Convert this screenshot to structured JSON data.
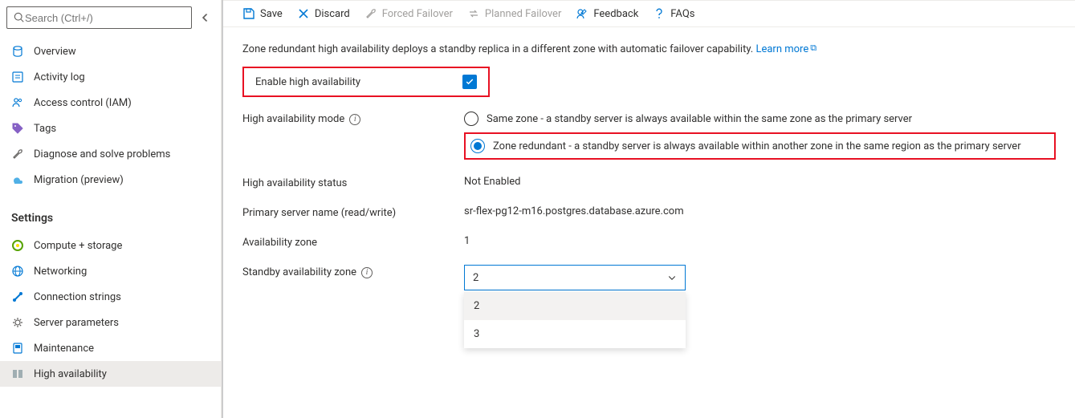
{
  "search": {
    "placeholder": "Search (Ctrl+/)"
  },
  "sidebar": {
    "items": [
      {
        "label": "Overview"
      },
      {
        "label": "Activity log"
      },
      {
        "label": "Access control (IAM)"
      },
      {
        "label": "Tags"
      },
      {
        "label": "Diagnose and solve problems"
      },
      {
        "label": "Migration (preview)"
      }
    ],
    "settings_label": "Settings",
    "settings_items": [
      {
        "label": "Compute + storage"
      },
      {
        "label": "Networking"
      },
      {
        "label": "Connection strings"
      },
      {
        "label": "Server parameters"
      },
      {
        "label": "Maintenance"
      },
      {
        "label": "High availability"
      }
    ]
  },
  "toolbar": {
    "save": "Save",
    "discard": "Discard",
    "forced_failover": "Forced Failover",
    "planned_failover": "Planned Failover",
    "feedback": "Feedback",
    "faqs": "FAQs"
  },
  "description_text": "Zone redundant high availability deploys a standby replica in a different zone with automatic failover capability. ",
  "learn_more": "Learn more",
  "enable_ha_label": "Enable high availability",
  "enable_ha_checked": true,
  "ha_mode": {
    "label": "High availability mode",
    "options": {
      "same_zone": "Same zone - a standby server is always available within the same zone as the primary server",
      "zone_redundant": "Zone redundant - a standby server is always available within another zone in the same region as the primary server"
    },
    "selected": "zone_redundant"
  },
  "ha_status": {
    "label": "High availability status",
    "value": "Not Enabled"
  },
  "primary_server": {
    "label": "Primary server name (read/write)",
    "value": "sr-flex-pg12-m16.postgres.database.azure.com"
  },
  "availability_zone": {
    "label": "Availability zone",
    "value": "1"
  },
  "standby_zone": {
    "label": "Standby availability zone",
    "selected": "2",
    "options": [
      "2",
      "3"
    ]
  }
}
